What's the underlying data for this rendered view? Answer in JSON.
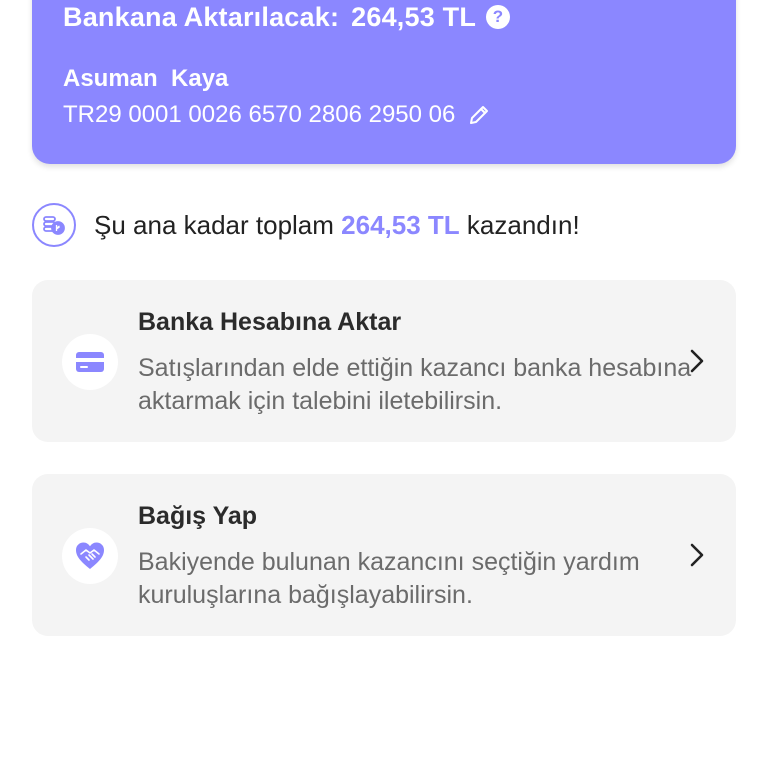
{
  "bank_card": {
    "transfer_label": "Bankana Aktarılacak:",
    "transfer_amount": "264,53 TL",
    "help_glyph": "?",
    "holder_name": "Asuman  Kaya",
    "iban": "TR29 0001 0026 6570 2806 2950 06"
  },
  "earnings": {
    "prefix": "Şu ana kadar toplam",
    "amount": "264,53 TL",
    "suffix": "kazandın!"
  },
  "options": {
    "bank_transfer": {
      "title": "Banka Hesabına Aktar",
      "description": "Satışlarından elde ettiğin kazancı banka hesabına aktarmak için talebini iletebilirsin.",
      "icon": "credit-card-icon"
    },
    "donate": {
      "title": "Bağış Yap",
      "description": "Bakiyende bulunan kazancını seçtiğin yardım kuruluşlarına bağışlayabilirsin.",
      "icon": "heart-handshake-icon"
    }
  },
  "colors": {
    "accent": "#8b87ff",
    "card_bg": "#f4f4f4",
    "text_primary": "#2b2b2b",
    "text_secondary": "#6b6b6b"
  }
}
